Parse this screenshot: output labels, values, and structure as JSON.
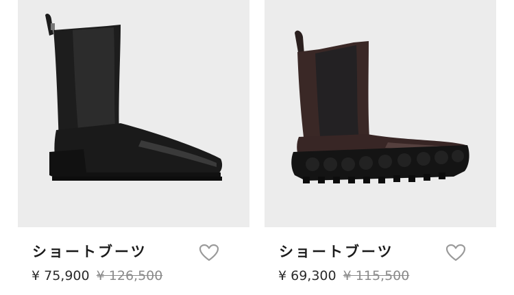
{
  "products": [
    {
      "name": "ショートブーツ",
      "price": "¥ 75,900",
      "original_price": "¥ 126,500",
      "favorite_icon": "heart-outline-icon",
      "image": "black-wedge-chelsea-boot"
    },
    {
      "name": "ショートブーツ",
      "price": "¥ 69,300",
      "original_price": "¥ 115,500",
      "favorite_icon": "heart-outline-icon",
      "image": "dark-brown-lug-sole-chelsea-boot"
    }
  ],
  "colors": {
    "image_background": "#ececec",
    "text": "#1b1b1b",
    "strikethrough_price": "#8a8a8a",
    "heart_outline": "#9a9a9a"
  }
}
